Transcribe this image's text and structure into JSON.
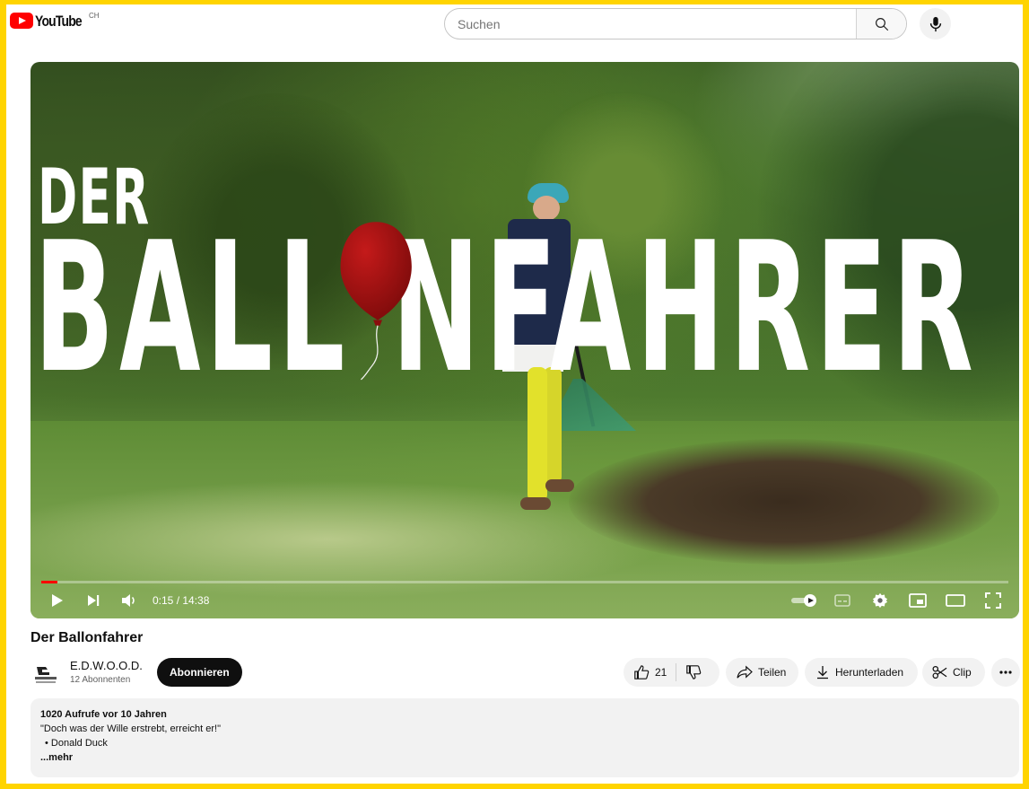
{
  "header": {
    "logo_text": "YouTube",
    "country_code": "CH",
    "search_placeholder": "Suchen"
  },
  "video": {
    "overlay_title_line1": "DER",
    "overlay_title_line2": "BALL NFAHRER",
    "current_time": "0:15",
    "duration": "14:38",
    "time_display": "0:15 / 14:38",
    "progress_fraction": 0.017
  },
  "meta": {
    "title": "Der Ballonfahrer",
    "channel_name": "E.D.W.O.O.D.",
    "subscriber_count": "12 Abonnenten",
    "subscribe_label": "Abonnieren",
    "like_count": "21",
    "share_label": "Teilen",
    "download_label": "Herunterladen",
    "clip_label": "Clip"
  },
  "description": {
    "stats": "1020 Aufrufe  vor 10 Jahren",
    "quote": "\"Doch was der Wille erstrebt, erreicht er!\"",
    "bullet": "Donald Duck",
    "more": "...mehr"
  },
  "colors": {
    "page_frame": "#ffd400",
    "brand_red": "#ff0000",
    "balloon": "#a01010"
  }
}
